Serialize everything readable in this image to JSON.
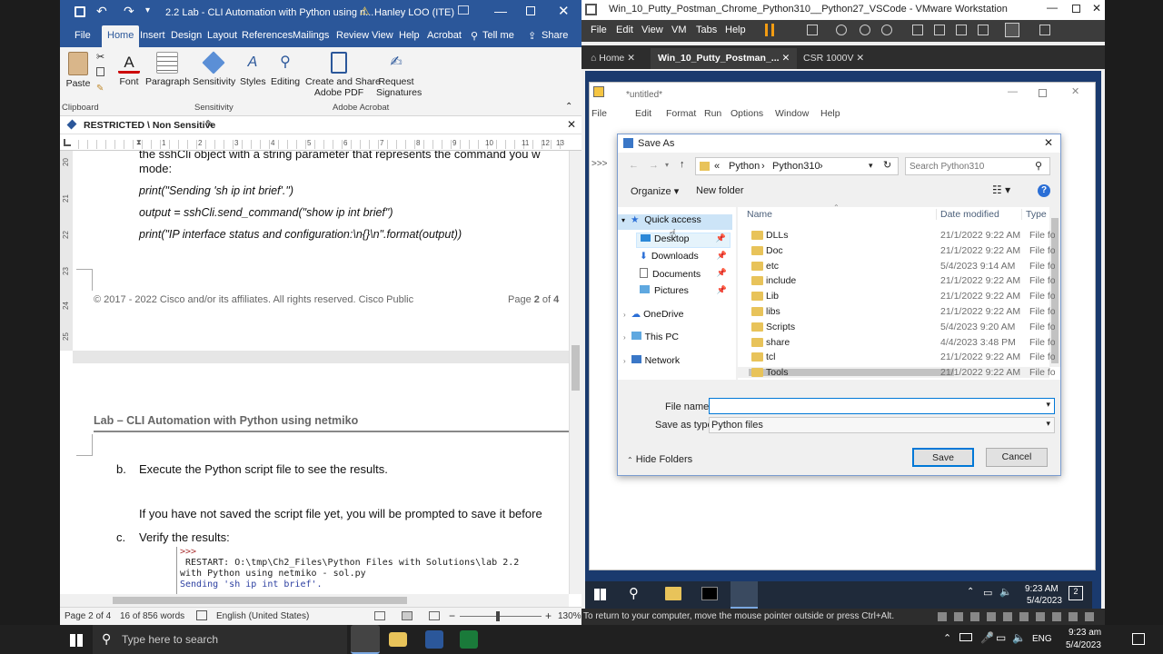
{
  "word": {
    "title": "2.2 Lab - CLI Automation with Python using n...",
    "user": "Hanley LOO (ITE)",
    "tabs": [
      "File",
      "Home",
      "Insert",
      "Design",
      "Layout",
      "References",
      "Mailings",
      "Review",
      "View",
      "Help",
      "Acrobat"
    ],
    "tell_me": "Tell me",
    "share": "Share",
    "ribbon": {
      "paste": "Paste",
      "font": "Font",
      "paragraph": "Paragraph",
      "sensitivity": "Sensitivity",
      "styles": "Styles",
      "editing": "Editing",
      "create_share_1": "Create and Share",
      "create_share_2": "Adobe PDF",
      "request_1": "Request",
      "request_2": "Signatures",
      "group_clipboard": "Clipboard",
      "group_sensitivity": "Sensitivity",
      "group_acrobat": "Adobe Acrobat"
    },
    "infobar": "RESTRICTED \\ Non Sensitive",
    "ruler_numbers": [
      "1",
      "2",
      "3",
      "4",
      "5",
      "6",
      "7",
      "8",
      "9",
      "10",
      "11",
      "12",
      "13"
    ],
    "vruler_numbers": [
      "20",
      "21",
      "22",
      "23",
      "24",
      "25"
    ],
    "doc": {
      "line0": "the sshCli object with a string parameter that represents the command you w",
      "line1": "mode:",
      "code1": "print(\"Sending 'sh ip int brief'.\")",
      "code2": "output = sshCli.send_command(\"show ip int brief\")",
      "code3": "print(\"IP interface status and configuration:\\n{}\\n\".format(output))",
      "footer_left": "© 2017 - 2022 Cisco and/or its affiliates. All rights reserved. Cisco Public",
      "footer_page_pre": "Page ",
      "footer_page_num": "2",
      "footer_page_mid": " of ",
      "footer_page_total": "4",
      "header": "Lab – CLI Automation with Python using netmiko",
      "step_b_letter": "b.",
      "step_b": "Execute the Python script file to see the results.",
      "step_b_note": "If you have not saved the script file yet, you will be prompted to save it before",
      "step_c_letter": "c.",
      "step_c": "Verify the results:",
      "shell1": ">>>",
      "shell2": " RESTART: O:\\tmp\\Ch2_Files\\Python Files with Solutions\\lab 2.2",
      "shell3": "with Python using netmiko - sol.py",
      "shell4": "Sending 'sh ip int brief'."
    },
    "status": {
      "page": "Page 2 of 4",
      "words": "16 of 856 words",
      "lang": "English (United States)",
      "zoom": "130%"
    }
  },
  "vmware": {
    "title": "Win_10_Putty_Postman_Chrome_Python310__Python27_VSCode - VMware Workstation",
    "menu": [
      "File",
      "Edit",
      "View",
      "VM",
      "Tabs",
      "Help"
    ],
    "tabs": [
      "Home",
      "Win_10_Putty_Postman_...",
      "CSR 1000V"
    ],
    "status_hint": "To return to your computer, move the mouse pointer outside or press Ctrl+Alt.",
    "idle": {
      "title": "*untitled*",
      "menu": [
        "File",
        "Edit",
        "Format",
        "Run",
        "Options",
        "Window",
        "Help"
      ],
      "prompt": ">>>"
    },
    "save_as": {
      "title": "Save As",
      "path": [
        "«",
        "Python",
        "Python310"
      ],
      "search_placeholder": "Search Python310",
      "organize": "Organize",
      "new_folder": "New folder",
      "nav": {
        "quick_access": "Quick access",
        "desktop": "Desktop",
        "downloads": "Downloads",
        "documents": "Documents",
        "pictures": "Pictures",
        "onedrive": "OneDrive",
        "this_pc": "This PC",
        "network": "Network"
      },
      "columns": {
        "name": "Name",
        "date": "Date modified",
        "type": "Type"
      },
      "files": [
        {
          "name": "DLLs",
          "date": "21/1/2022 9:22 AM",
          "type": "File fol"
        },
        {
          "name": "Doc",
          "date": "21/1/2022 9:22 AM",
          "type": "File fol"
        },
        {
          "name": "etc",
          "date": "5/4/2023 9:14 AM",
          "type": "File fol"
        },
        {
          "name": "include",
          "date": "21/1/2022 9:22 AM",
          "type": "File fol"
        },
        {
          "name": "Lib",
          "date": "21/1/2022 9:22 AM",
          "type": "File fol"
        },
        {
          "name": "libs",
          "date": "21/1/2022 9:22 AM",
          "type": "File fol"
        },
        {
          "name": "Scripts",
          "date": "5/4/2023 9:20 AM",
          "type": "File fol"
        },
        {
          "name": "share",
          "date": "4/4/2023 3:48 PM",
          "type": "File fol"
        },
        {
          "name": "tcl",
          "date": "21/1/2022 9:22 AM",
          "type": "File fol"
        },
        {
          "name": "Tools",
          "date": "21/1/2022 9:22 AM",
          "type": "File fol"
        }
      ],
      "file_name_label": "File name:",
      "file_name_value": "",
      "save_type_label": "Save as type:",
      "save_type_value": "Python files",
      "hide_folders": "Hide Folders",
      "save": "Save",
      "cancel": "Cancel"
    },
    "guest_clock": {
      "time": "9:23 AM",
      "date": "5/4/2023"
    },
    "guest_notif": "2"
  },
  "host_taskbar": {
    "search": "Type here to search",
    "lang": "ENG",
    "time": "9:23 am",
    "date": "5/4/2023"
  },
  "colors": {
    "word_blue": "#2b579a",
    "vm_dark": "#3c3c3c",
    "folder_yellow": "#e8c35a",
    "accent": "#0078d7"
  }
}
